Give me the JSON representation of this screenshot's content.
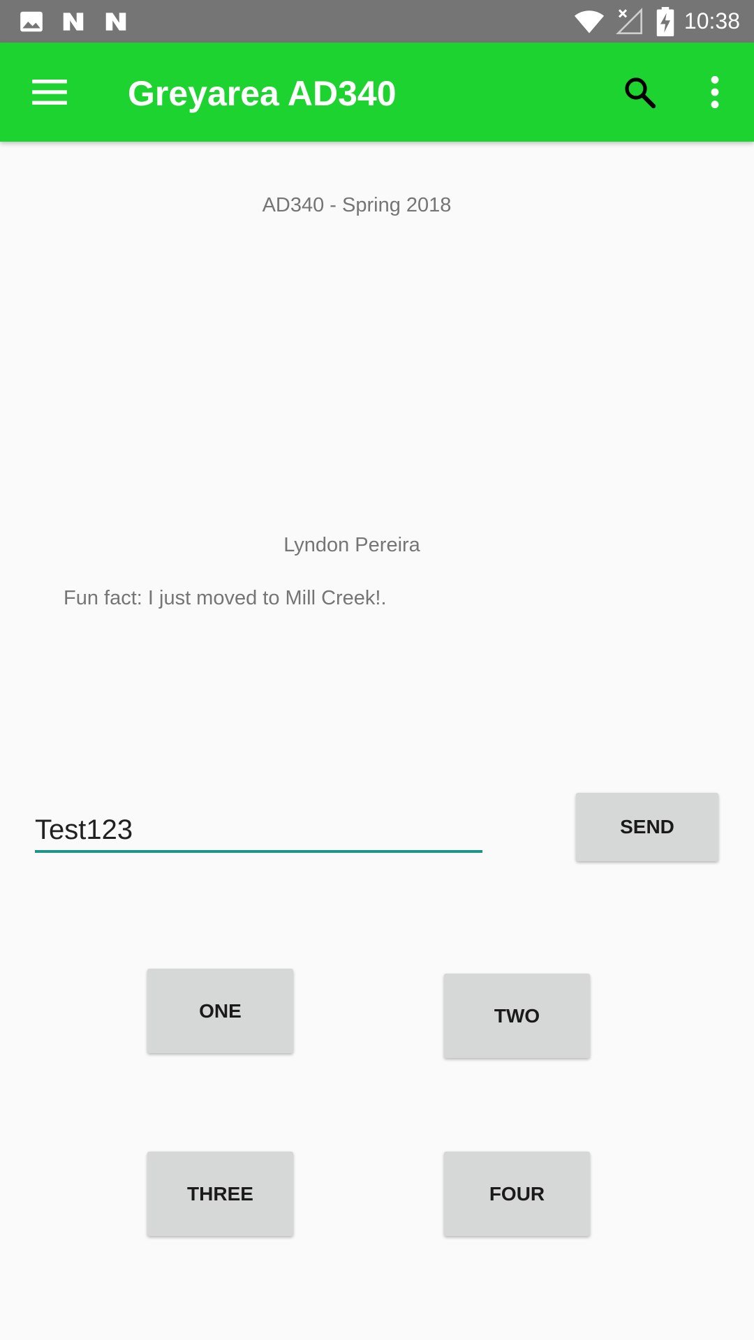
{
  "status_bar": {
    "time": "10:38",
    "left_icons": [
      "image-icon",
      "n-notification-icon",
      "n-notification-icon"
    ],
    "right_icons": [
      "wifi-icon",
      "cell-signal-off-icon",
      "battery-charging-icon"
    ]
  },
  "app_bar": {
    "title": "Greyarea AD340",
    "icons": [
      "menu-icon",
      "search-icon",
      "more-vert-icon"
    ],
    "color": "#1dd32f"
  },
  "content": {
    "course": "AD340 - Spring 2018",
    "name": "Lyndon Pereira",
    "fun_fact": "Fun fact: I just moved to Mill Creek!."
  },
  "message": {
    "value": "Test123",
    "underline_color": "#1e9486"
  },
  "buttons": {
    "send": "SEND",
    "one": "ONE",
    "two": "TWO",
    "three": "THREE",
    "four": "FOUR"
  }
}
